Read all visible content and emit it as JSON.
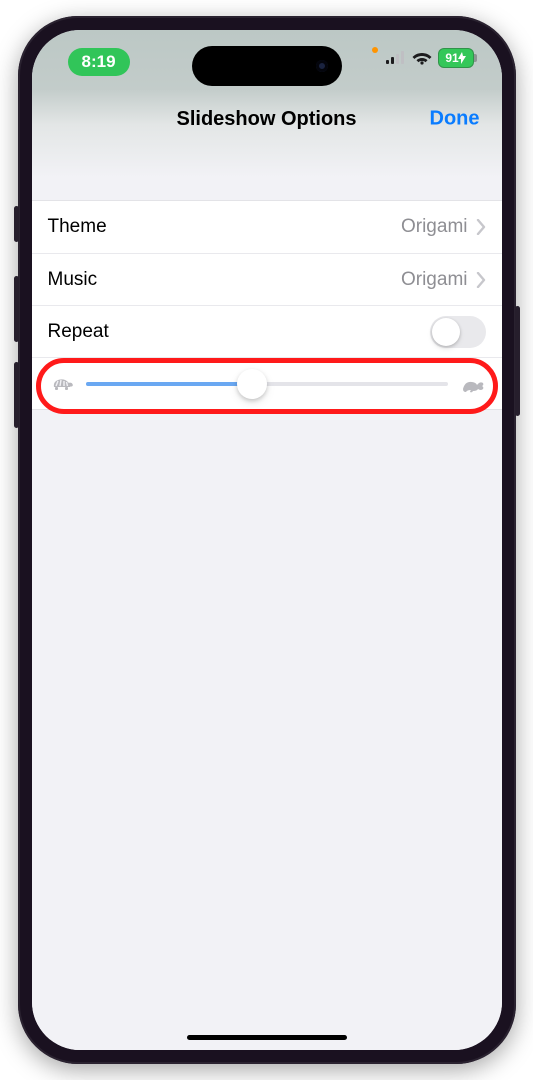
{
  "status": {
    "time": "8:19",
    "battery": "91"
  },
  "nav": {
    "title": "Slideshow Options",
    "done": "Done"
  },
  "rows": {
    "theme": {
      "label": "Theme",
      "value": "Origami"
    },
    "music": {
      "label": "Music",
      "value": "Origami"
    },
    "repeat": {
      "label": "Repeat",
      "enabled": false
    }
  },
  "slider": {
    "value_pct": 46
  }
}
